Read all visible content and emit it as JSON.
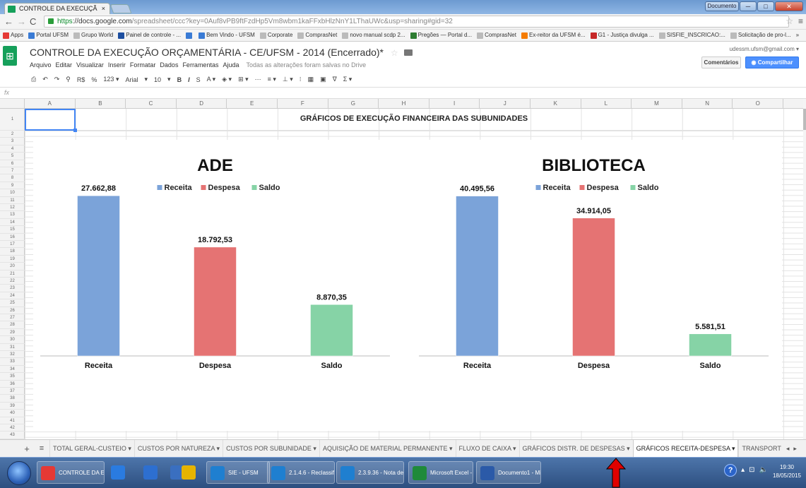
{
  "browser": {
    "tab_title": "CONTROLE DA EXECUÇÃ",
    "tab_close": "×",
    "url_https": "https",
    "url_host": "://docs.google.com",
    "url_rest": "/spreadsheet/ccc?key=0Auf8vPB9ftFzdHp5Vm8wbm1kaFFxbHlzNnY1LThaUWc&usp=sharing#gid=32",
    "bookmarks": [
      {
        "label": "Apps",
        "color": "#e53935"
      },
      {
        "label": "Portal UFSM",
        "color": "#3a7bd5"
      },
      {
        "label": "Grupo World",
        "color": "#bbbbbb"
      },
      {
        "label": "Painel de controle - ...",
        "color": "#1e4fa0"
      },
      {
        "label": "",
        "color": "#3a7bd5"
      },
      {
        "label": "Bem Vindo - UFSM",
        "color": "#3a7bd5"
      },
      {
        "label": "Corporate",
        "color": "#bbbbbb"
      },
      {
        "label": "ComprasNet",
        "color": "#bbbbbb"
      },
      {
        "label": "novo manual scdp 2...",
        "color": "#bbbbbb"
      },
      {
        "label": "Pregões — Portal d...",
        "color": "#2e7d32"
      },
      {
        "label": "ComprasNet",
        "color": "#bbbbbb"
      },
      {
        "label": "Ex-reitor da UFSM é...",
        "color": "#f57c00"
      },
      {
        "label": "G1 - Justiça divulga ...",
        "color": "#c62828"
      },
      {
        "label": "SISFIE_INSCRICAO:...",
        "color": "#bbbbbb"
      },
      {
        "label": "Solicitação de pro-l...",
        "color": "#bbbbbb"
      }
    ],
    "bookmarks_more": "»",
    "window_user": "Documento"
  },
  "doc": {
    "title": "CONTROLE DA EXECUÇÃO ORÇAMENTÁRIA - CE/UFSM - 2014 (Encerrado)*",
    "star": "☆",
    "menus": [
      "Arquivo",
      "Editar",
      "Visualizar",
      "Inserir",
      "Formatar",
      "Dados",
      "Ferramentas",
      "Ajuda"
    ],
    "saved_status": "Todas as alterações foram salvas no Drive",
    "user_email": "udessm.ufsm@gmail.com ▾",
    "comments_label": "Comentários",
    "share_label": "Compartilhar"
  },
  "toolbar": {
    "items": [
      "⎙",
      "↶",
      "↷",
      "⚲",
      "R$",
      "%",
      "123 ▾",
      "Arial",
      "▾",
      "10",
      "▾",
      "B",
      "I",
      "S",
      "A ▾",
      "◈ ▾",
      "⊞ ▾",
      "⋯",
      "≡ ▾",
      "⊥ ▾",
      "⁝",
      "▦",
      "▣",
      "∇",
      "Σ ▾"
    ],
    "fx_label": "fx"
  },
  "grid": {
    "columns": [
      "A",
      "B",
      "C",
      "D",
      "E",
      "F",
      "G",
      "H",
      "I",
      "J",
      "K",
      "L",
      "M",
      "N",
      "O"
    ],
    "rows": [
      "1",
      "2",
      "3",
      "4",
      "5",
      "6",
      "7",
      "8",
      "9",
      "10",
      "11",
      "12",
      "13",
      "14",
      "15",
      "16",
      "17",
      "18",
      "19",
      "20",
      "21",
      "22",
      "23",
      "24",
      "25",
      "26",
      "27",
      "28",
      "29",
      "30",
      "31",
      "32",
      "33",
      "34",
      "35",
      "36",
      "37",
      "38",
      "39",
      "40",
      "41",
      "42",
      "43"
    ],
    "heading": "GRÁFICOS DE EXECUÇÃO FINANCEIRA DAS SUBUNIDADES"
  },
  "chart_data": [
    {
      "type": "bar",
      "title": "ADE",
      "categories": [
        "Receita",
        "Despesa",
        "Saldo"
      ],
      "values": [
        27662.88,
        18792.53,
        8870.35
      ],
      "value_labels": [
        "27.662,88",
        "18.792,53",
        "8.870,35"
      ],
      "legend": [
        "Receita",
        "Despesa",
        "Saldo"
      ],
      "colors": [
        "#7ba3d9",
        "#e57373",
        "#86d3a6"
      ],
      "ylim": [
        0,
        30000
      ],
      "grid": false,
      "legend_position": "top"
    },
    {
      "type": "bar",
      "title": "BIBLIOTECA",
      "categories": [
        "Receita",
        "Despesa",
        "Saldo"
      ],
      "values": [
        40495.56,
        34914.05,
        5581.51
      ],
      "value_labels": [
        "40.495,56",
        "34.914,05",
        "5.581,51"
      ],
      "legend": [
        "Receita",
        "Despesa",
        "Saldo"
      ],
      "colors": [
        "#7ba3d9",
        "#e57373",
        "#86d3a6"
      ],
      "ylim": [
        0,
        44000
      ],
      "grid": false,
      "legend_position": "top"
    }
  ],
  "sheet_tabs": {
    "plus": "+",
    "list": "≡",
    "tabs": [
      {
        "label": "TOTAL GERAL-CUSTEIO ▾",
        "active": false
      },
      {
        "label": "CUSTOS POR NATUREZA ▾",
        "active": false
      },
      {
        "label": "CUSTOS POR SUBUNIDADE ▾",
        "active": false
      },
      {
        "label": "AQUISIÇÃO DE MATERIAL PERMANENTE ▾",
        "active": false
      },
      {
        "label": "FLUXO DE CAIXA ▾",
        "active": false
      },
      {
        "label": "GRÁFICOS DISTR. DE DESPESAS ▾",
        "active": false
      },
      {
        "label": "GRÁFICOS RECEITA-DESPESA ▾",
        "active": true
      },
      {
        "label": "TRANSPORT",
        "active": false
      }
    ],
    "prev": "◂",
    "next": "▸"
  },
  "taskbar": {
    "items": [
      {
        "label": "CONTROLE DA E...",
        "color": "#e53935",
        "button": true
      },
      {
        "label": "",
        "color": "#2a7be0",
        "button": false
      },
      {
        "label": "",
        "color": "#2d6fd0",
        "button": false
      },
      {
        "label": "",
        "color": "#3a6fc0",
        "button": false
      },
      {
        "label": "",
        "color": "#e6b400",
        "button": false
      },
      {
        "label": "SIE - UFSM",
        "color": "#1f7fd0",
        "button": true
      },
      {
        "label": "2.1.4.6 - Reclassifi...",
        "color": "#1f7fd0",
        "button": true
      },
      {
        "label": "2.3.9.36 - Nota de ...",
        "color": "#1f7fd0",
        "button": true
      },
      {
        "label": "Microsoft Excel - ...",
        "color": "#1f8a3a",
        "button": true
      },
      {
        "label": "Documento1 - Mi...",
        "color": "#2b5aa8",
        "button": true
      }
    ],
    "help": "?",
    "tray": [
      "▴",
      "⊡",
      "🔈"
    ],
    "time": "19:30",
    "date": "18/05/2015"
  },
  "annotation_color": "#e00000"
}
